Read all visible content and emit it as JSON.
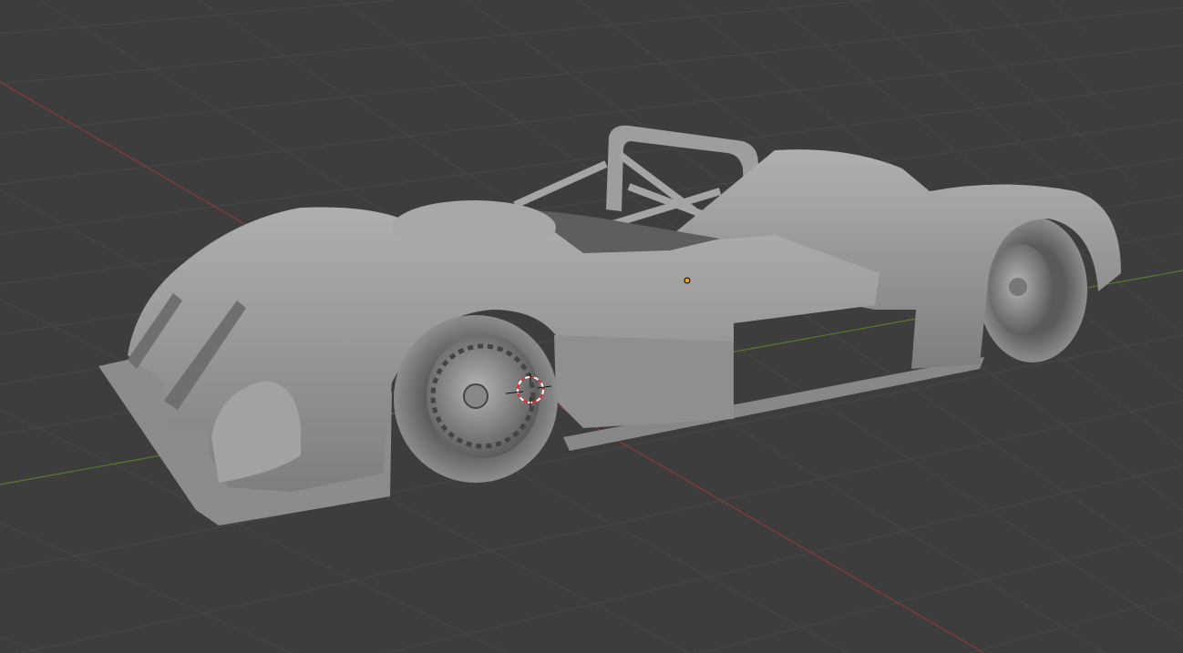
{
  "viewport": {
    "background_color": "#3d3d3d",
    "grid_color": "#474747",
    "x_axis_color": "#8a3a3a",
    "y_axis_color": "#5a7a2e",
    "model_color": "#9a9a9a",
    "cursor_colors": [
      "#e03030",
      "#ffffff"
    ],
    "origin_color": "#f0a020"
  }
}
